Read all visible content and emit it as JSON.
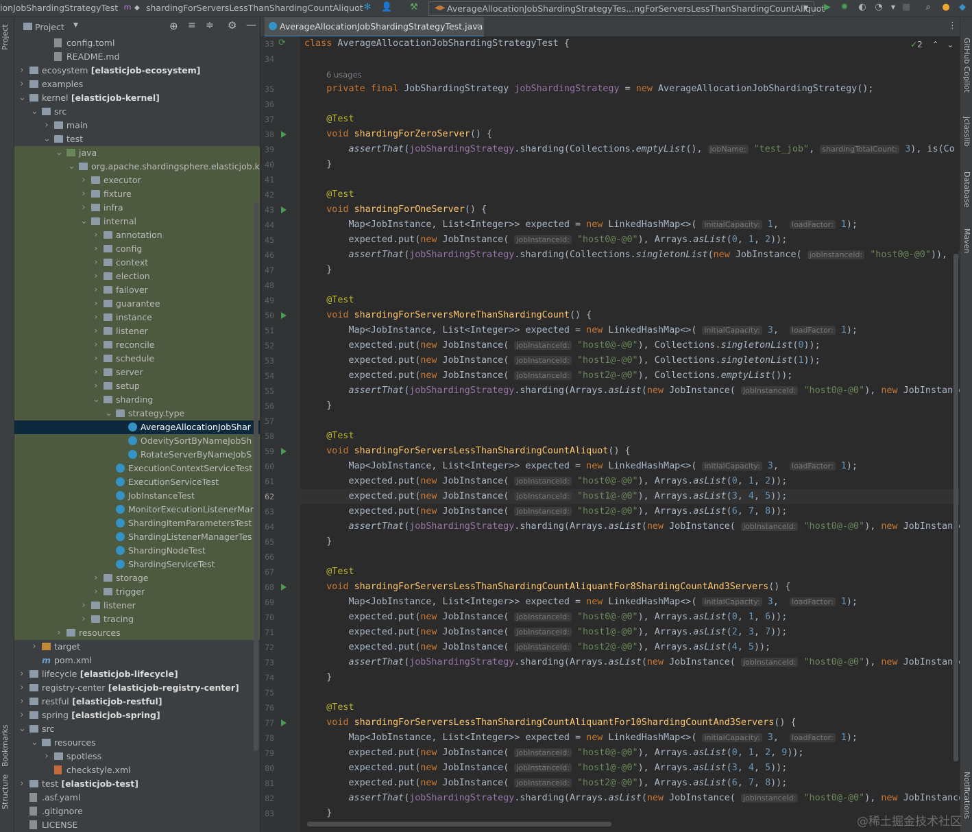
{
  "topbar": {
    "crumb_class": "ionJobShardingStrategyTest",
    "crumb_method": "shardingForServersLessThanShardingCountAliquot",
    "run_config": "AverageAllocationJobShardingStrategyTes...ngForServersLessThanShardingCountAliquot"
  },
  "stripes": {
    "project": "Project",
    "bookmarks": "Bookmarks",
    "structure": "Structure",
    "github_copilot": "GitHub Copilot",
    "jclasslib": "jclasslib",
    "database": "Database",
    "maven": "Maven",
    "notifications": "Notifications"
  },
  "project_panel": {
    "title": "Project",
    "tree": [
      {
        "label": "config.toml",
        "level": 3,
        "icon": "file",
        "expander": "none"
      },
      {
        "label": "README.md",
        "level": 3,
        "icon": "file",
        "expander": "none"
      },
      {
        "label": "ecosystem",
        "module": "[elasticjob-ecosystem]",
        "level": 1,
        "icon": "folder",
        "expander": "collapsed"
      },
      {
        "label": "examples",
        "level": 1,
        "icon": "folder",
        "expander": "collapsed"
      },
      {
        "label": "kernel",
        "module": "[elasticjob-kernel]",
        "level": 1,
        "icon": "folder",
        "expander": "expanded"
      },
      {
        "label": "src",
        "level": 2,
        "icon": "folder",
        "expander": "expanded"
      },
      {
        "label": "main",
        "level": 3,
        "icon": "folder",
        "expander": "collapsed"
      },
      {
        "label": "test",
        "level": 3,
        "icon": "folder",
        "expander": "expanded"
      },
      {
        "label": "java",
        "level": 4,
        "icon": "folder-green",
        "expander": "expanded"
      },
      {
        "label": "org.apache.shardingsphere.elasticjob.k",
        "level": 5,
        "icon": "folder",
        "expander": "expanded"
      },
      {
        "label": "executor",
        "level": 6,
        "icon": "folder",
        "expander": "collapsed"
      },
      {
        "label": "fixture",
        "level": 6,
        "icon": "folder",
        "expander": "collapsed"
      },
      {
        "label": "infra",
        "level": 6,
        "icon": "folder",
        "expander": "collapsed"
      },
      {
        "label": "internal",
        "level": 6,
        "icon": "folder",
        "expander": "expanded"
      },
      {
        "label": "annotation",
        "level": 7,
        "icon": "folder",
        "expander": "collapsed"
      },
      {
        "label": "config",
        "level": 7,
        "icon": "folder",
        "expander": "collapsed"
      },
      {
        "label": "context",
        "level": 7,
        "icon": "folder",
        "expander": "collapsed"
      },
      {
        "label": "election",
        "level": 7,
        "icon": "folder",
        "expander": "collapsed"
      },
      {
        "label": "failover",
        "level": 7,
        "icon": "folder",
        "expander": "collapsed"
      },
      {
        "label": "guarantee",
        "level": 7,
        "icon": "folder",
        "expander": "collapsed"
      },
      {
        "label": "instance",
        "level": 7,
        "icon": "folder",
        "expander": "collapsed"
      },
      {
        "label": "listener",
        "level": 7,
        "icon": "folder",
        "expander": "collapsed"
      },
      {
        "label": "reconcile",
        "level": 7,
        "icon": "folder",
        "expander": "collapsed"
      },
      {
        "label": "schedule",
        "level": 7,
        "icon": "folder",
        "expander": "collapsed"
      },
      {
        "label": "server",
        "level": 7,
        "icon": "folder",
        "expander": "collapsed"
      },
      {
        "label": "setup",
        "level": 7,
        "icon": "folder",
        "expander": "collapsed"
      },
      {
        "label": "sharding",
        "level": 7,
        "icon": "folder",
        "expander": "expanded"
      },
      {
        "label": "strategy.type",
        "level": 8,
        "icon": "folder",
        "expander": "expanded"
      },
      {
        "label": "AverageAllocationJobShar",
        "level": 9,
        "icon": "class",
        "expander": "none",
        "selected": true
      },
      {
        "label": "OdevitySortByNameJobSh",
        "level": 9,
        "icon": "class",
        "expander": "none"
      },
      {
        "label": "RotateServerByNameJobS",
        "level": 9,
        "icon": "class",
        "expander": "none"
      },
      {
        "label": "ExecutionContextServiceTest",
        "level": 8,
        "icon": "class",
        "expander": "none"
      },
      {
        "label": "ExecutionServiceTest",
        "level": 8,
        "icon": "class",
        "expander": "none"
      },
      {
        "label": "JobInstanceTest",
        "level": 8,
        "icon": "class",
        "expander": "none"
      },
      {
        "label": "MonitorExecutionListenerMan",
        "level": 8,
        "icon": "class",
        "expander": "none"
      },
      {
        "label": "ShardingItemParametersTest",
        "level": 8,
        "icon": "class",
        "expander": "none"
      },
      {
        "label": "ShardingListenerManagerTes",
        "level": 8,
        "icon": "class",
        "expander": "none"
      },
      {
        "label": "ShardingNodeTest",
        "level": 8,
        "icon": "class",
        "expander": "none"
      },
      {
        "label": "ShardingServiceTest",
        "level": 8,
        "icon": "class",
        "expander": "none"
      },
      {
        "label": "storage",
        "level": 7,
        "icon": "folder",
        "expander": "collapsed"
      },
      {
        "label": "trigger",
        "level": 7,
        "icon": "folder",
        "expander": "collapsed"
      },
      {
        "label": "listener",
        "level": 6,
        "icon": "folder",
        "expander": "collapsed"
      },
      {
        "label": "tracing",
        "level": 6,
        "icon": "folder",
        "expander": "collapsed"
      },
      {
        "label": "resources",
        "level": 4,
        "icon": "folder",
        "expander": "collapsed"
      },
      {
        "label": "target",
        "level": 2,
        "icon": "folder-orange",
        "expander": "collapsed"
      },
      {
        "label": "pom.xml",
        "level": 2,
        "icon": "maven",
        "expander": "none"
      },
      {
        "label": "lifecycle",
        "module": "[elasticjob-lifecycle]",
        "level": 1,
        "icon": "folder",
        "expander": "collapsed"
      },
      {
        "label": "registry-center",
        "module": "[elasticjob-registry-center]",
        "level": 1,
        "icon": "folder",
        "expander": "collapsed"
      },
      {
        "label": "restful",
        "module": "[elasticjob-restful]",
        "level": 1,
        "icon": "folder",
        "expander": "collapsed"
      },
      {
        "label": "spring",
        "module": "[elasticjob-spring]",
        "level": 1,
        "icon": "folder",
        "expander": "collapsed"
      },
      {
        "label": "src",
        "level": 1,
        "icon": "folder",
        "expander": "expanded"
      },
      {
        "label": "resources",
        "level": 2,
        "icon": "folder",
        "expander": "expanded"
      },
      {
        "label": "spotless",
        "level": 3,
        "icon": "folder",
        "expander": "collapsed"
      },
      {
        "label": "checkstyle.xml",
        "level": 3,
        "icon": "xml",
        "expander": "none"
      },
      {
        "label": "test",
        "module": "[elasticjob-test]",
        "level": 1,
        "icon": "folder",
        "expander": "collapsed"
      },
      {
        "label": ".asf.yaml",
        "level": 1,
        "icon": "file",
        "expander": "none"
      },
      {
        "label": ".gitignore",
        "level": 1,
        "icon": "file",
        "expander": "none"
      },
      {
        "label": "LICENSE",
        "level": 1,
        "icon": "file",
        "expander": "none"
      }
    ]
  },
  "editor": {
    "tab_label": "AverageAllocationJobShardingStrategyTest.java",
    "inspection_count": "2",
    "current_line": 62,
    "run_lines": [
      38,
      43,
      50,
      59,
      68,
      77
    ],
    "lines": [
      {
        "n": "33",
        "html": "<span style='color:#cc7832'>class</span> AverageAllocationJobShardingStrategyTest {"
      },
      {
        "n": "34",
        "html": ""
      },
      {
        "n": "",
        "usages": "6 usages"
      },
      {
        "n": "35",
        "html": "    <span style='color:#cc7832'>private final</span> JobShardingStrategy <span style='color:#9876aa'>jobShardingStrategy</span> = <span style='color:#cc7832'>new</span> AverageAllocationJobShardingStrategy();"
      },
      {
        "n": "36",
        "html": ""
      },
      {
        "n": "37",
        "html": "    <span style='color:#bbb529'>@Test</span>"
      },
      {
        "n": "38",
        "html": "    <span style='color:#cc7832'>void</span> <span style='color:#ffc66d'>shardingForZeroServer</span>() {"
      },
      {
        "n": "39",
        "html": "        <i>assertThat</i>(<span style='color:#9876aa'>jobShardingStrategy</span>.sharding(Collections.<i>emptyList</i>(), <span class='hint'>jobName:</span> <span style='color:#6a8759'>\"test_job\"</span>, <span class='hint'>shardingTotalCount:</span> <span style='color:#6897bb'>3</span>), is(Co"
      },
      {
        "n": "40",
        "html": "    }"
      },
      {
        "n": "41",
        "html": ""
      },
      {
        "n": "42",
        "html": "    <span style='color:#bbb529'>@Test</span>"
      },
      {
        "n": "43",
        "html": "    <span style='color:#cc7832'>void</span> <span style='color:#ffc66d'>shardingForOneServer</span>() {"
      },
      {
        "n": "44",
        "html": "        Map&lt;JobInstance, List&lt;Integer&gt;&gt; expected = <span style='color:#cc7832'>new</span> LinkedHashMap&lt;&gt;( <span class='hint'>initialCapacity:</span> <span style='color:#6897bb'>1</span>,  <span class='hint'>loadFactor:</span> <span style='color:#6897bb'>1</span>);"
      },
      {
        "n": "45",
        "html": "        expected.put(<span style='color:#cc7832'>new</span> JobInstance( <span class='hint'>jobInstanceId:</span> <span style='color:#6a8759'>\"host0@-@0\"</span>), Arrays.<i>asList</i>(<span style='color:#6897bb'>0</span>, <span style='color:#6897bb'>1</span>, <span style='color:#6897bb'>2</span>));"
      },
      {
        "n": "46",
        "html": "        <i>assertThat</i>(<span style='color:#9876aa'>jobShardingStrategy</span>.sharding(Collections.<i>singletonList</i>(<span style='color:#cc7832'>new</span> JobInstance( <span class='hint'>jobInstanceId:</span> <span style='color:#6a8759'>\"host0@-@0\"</span>)),  <span class='hint'>job</span>"
      },
      {
        "n": "47",
        "html": "    }"
      },
      {
        "n": "48",
        "html": ""
      },
      {
        "n": "49",
        "html": "    <span style='color:#bbb529'>@Test</span>"
      },
      {
        "n": "50",
        "html": "    <span style='color:#cc7832'>void</span> <span style='color:#ffc66d'>shardingForServersMoreThanShardingCount</span>() {"
      },
      {
        "n": "51",
        "html": "        Map&lt;JobInstance, List&lt;Integer&gt;&gt; expected = <span style='color:#cc7832'>new</span> LinkedHashMap&lt;&gt;( <span class='hint'>initialCapacity:</span> <span style='color:#6897bb'>3</span>,  <span class='hint'>loadFactor:</span> <span style='color:#6897bb'>1</span>);"
      },
      {
        "n": "52",
        "html": "        expected.put(<span style='color:#cc7832'>new</span> JobInstance( <span class='hint'>jobInstanceId:</span> <span style='color:#6a8759'>\"host0@-@0\"</span>), Collections.<i>singletonList</i>(<span style='color:#6897bb'>0</span>));"
      },
      {
        "n": "53",
        "html": "        expected.put(<span style='color:#cc7832'>new</span> JobInstance( <span class='hint'>jobInstanceId:</span> <span style='color:#6a8759'>\"host1@-@0\"</span>), Collections.<i>singletonList</i>(<span style='color:#6897bb'>1</span>));"
      },
      {
        "n": "54",
        "html": "        expected.put(<span style='color:#cc7832'>new</span> JobInstance( <span class='hint'>jobInstanceId:</span> <span style='color:#6a8759'>\"host2@-@0\"</span>), Collections.<i>emptyList</i>());"
      },
      {
        "n": "55",
        "html": "        <i>assertThat</i>(<span style='color:#9876aa'>jobShardingStrategy</span>.sharding(Arrays.<i>asList</i>(<span style='color:#cc7832'>new</span> JobInstance( <span class='hint'>jobInstanceId:</span> <span style='color:#6a8759'>\"host0@-@0\"</span>), <span style='color:#cc7832'>new</span> JobInstance("
      },
      {
        "n": "56",
        "html": "    }"
      },
      {
        "n": "57",
        "html": ""
      },
      {
        "n": "58",
        "html": "    <span style='color:#bbb529'>@Test</span>"
      },
      {
        "n": "59",
        "html": "    <span style='color:#cc7832'>void</span> <span style='color:#ffc66d'>shardingForServersLessThanShardingCountAliquot</span>() {"
      },
      {
        "n": "60",
        "html": "        Map&lt;JobInstance, List&lt;Integer&gt;&gt; expected = <span style='color:#cc7832'>new</span> LinkedHashMap&lt;&gt;( <span class='hint'>initialCapacity:</span> <span style='color:#6897bb'>3</span>,  <span class='hint'>loadFactor:</span> <span style='color:#6897bb'>1</span>);"
      },
      {
        "n": "61",
        "html": "        expected.put(<span style='color:#cc7832'>new</span> JobInstance( <span class='hint'>jobInstanceId:</span> <span style='color:#6a8759'>\"host0@-@0\"</span>), Arrays.<i>asList</i>(<span style='color:#6897bb'>0</span>, <span style='color:#6897bb'>1</span>, <span style='color:#6897bb'>2</span>));"
      },
      {
        "n": "62",
        "html": "        expected.put(<span style='color:#cc7832'>new</span> JobInstance( <span class='hint'>jobInstanceId:</span> <span style='color:#6a8759'>\"host1@-@0\"</span>), Arrays.<i>asList</i>(<span style='color:#6897bb'>3</span>, <span style='color:#6897bb'>4</span>, <span style='color:#6897bb'>5</span>));"
      },
      {
        "n": "63",
        "html": "        expected.put(<span style='color:#cc7832'>new</span> JobInstance( <span class='hint'>jobInstanceId:</span> <span style='color:#6a8759'>\"host2@-@0\"</span>), Arrays.<i>asList</i>(<span style='color:#6897bb'>6</span>, <span style='color:#6897bb'>7</span>, <span style='color:#6897bb'>8</span>));"
      },
      {
        "n": "64",
        "html": "        <i>assertThat</i>(<span style='color:#9876aa'>jobShardingStrategy</span>.sharding(Arrays.<i>asList</i>(<span style='color:#cc7832'>new</span> JobInstance( <span class='hint'>jobInstanceId:</span> <span style='color:#6a8759'>\"host0@-@0\"</span>), <span style='color:#cc7832'>new</span> JobInstance("
      },
      {
        "n": "65",
        "html": "    }"
      },
      {
        "n": "66",
        "html": ""
      },
      {
        "n": "67",
        "html": "    <span style='color:#bbb529'>@Test</span>"
      },
      {
        "n": "68",
        "html": "    <span style='color:#cc7832'>void</span> <span style='color:#ffc66d'>shardingForServersLessThanShardingCountAliquantFor8ShardingCountAnd3Servers</span>() {"
      },
      {
        "n": "69",
        "html": "        Map&lt;JobInstance, List&lt;Integer&gt;&gt; expected = <span style='color:#cc7832'>new</span> LinkedHashMap&lt;&gt;( <span class='hint'>initialCapacity:</span> <span style='color:#6897bb'>3</span>,  <span class='hint'>loadFactor:</span> <span style='color:#6897bb'>1</span>);"
      },
      {
        "n": "70",
        "html": "        expected.put(<span style='color:#cc7832'>new</span> JobInstance( <span class='hint'>jobInstanceId:</span> <span style='color:#6a8759'>\"host0@-@0\"</span>), Arrays.<i>asList</i>(<span style='color:#6897bb'>0</span>, <span style='color:#6897bb'>1</span>, <span style='color:#6897bb'>6</span>));"
      },
      {
        "n": "71",
        "html": "        expected.put(<span style='color:#cc7832'>new</span> JobInstance( <span class='hint'>jobInstanceId:</span> <span style='color:#6a8759'>\"host1@-@0\"</span>), Arrays.<i>asList</i>(<span style='color:#6897bb'>2</span>, <span style='color:#6897bb'>3</span>, <span style='color:#6897bb'>7</span>));"
      },
      {
        "n": "72",
        "html": "        expected.put(<span style='color:#cc7832'>new</span> JobInstance( <span class='hint'>jobInstanceId:</span> <span style='color:#6a8759'>\"host2@-@0\"</span>), Arrays.<i>asList</i>(<span style='color:#6897bb'>4</span>, <span style='color:#6897bb'>5</span>));"
      },
      {
        "n": "73",
        "html": "        <i>assertThat</i>(<span style='color:#9876aa'>jobShardingStrategy</span>.sharding(Arrays.<i>asList</i>(<span style='color:#cc7832'>new</span> JobInstance( <span class='hint'>jobInstanceId:</span> <span style='color:#6a8759'>\"host0@-@0\"</span>), <span style='color:#cc7832'>new</span> JobInstance("
      },
      {
        "n": "74",
        "html": "    }"
      },
      {
        "n": "75",
        "html": ""
      },
      {
        "n": "76",
        "html": "    <span style='color:#bbb529'>@Test</span>"
      },
      {
        "n": "77",
        "html": "    <span style='color:#cc7832'>void</span> <span style='color:#ffc66d'>shardingForServersLessThanShardingCountAliquantFor10ShardingCountAnd3Servers</span>() {"
      },
      {
        "n": "78",
        "html": "        Map&lt;JobInstance, List&lt;Integer&gt;&gt; expected = <span style='color:#cc7832'>new</span> LinkedHashMap&lt;&gt;( <span class='hint'>initialCapacity:</span> <span style='color:#6897bb'>3</span>,  <span class='hint'>loadFactor:</span> <span style='color:#6897bb'>1</span>);"
      },
      {
        "n": "79",
        "html": "        expected.put(<span style='color:#cc7832'>new</span> JobInstance( <span class='hint'>jobInstanceId:</span> <span style='color:#6a8759'>\"host0@-@0\"</span>), Arrays.<i>asList</i>(<span style='color:#6897bb'>0</span>, <span style='color:#6897bb'>1</span>, <span style='color:#6897bb'>2</span>, <span style='color:#6897bb'>9</span>));"
      },
      {
        "n": "80",
        "html": "        expected.put(<span style='color:#cc7832'>new</span> JobInstance( <span class='hint'>jobInstanceId:</span> <span style='color:#6a8759'>\"host1@-@0\"</span>), Arrays.<i>asList</i>(<span style='color:#6897bb'>3</span>, <span style='color:#6897bb'>4</span>, <span style='color:#6897bb'>5</span>));"
      },
      {
        "n": "81",
        "html": "        expected.put(<span style='color:#cc7832'>new</span> JobInstance( <span class='hint'>jobInstanceId:</span> <span style='color:#6a8759'>\"host2@-@0\"</span>), Arrays.<i>asList</i>(<span style='color:#6897bb'>6</span>, <span style='color:#6897bb'>7</span>, <span style='color:#6897bb'>8</span>));"
      },
      {
        "n": "82",
        "html": "        <i>assertThat</i>(<span style='color:#9876aa'>jobShardingStrategy</span>.sharding(Arrays.<i>asList</i>(<span style='color:#cc7832'>new</span> JobInstance( <span class='hint'>jobInstanceId:</span> <span style='color:#6a8759'>\"host0@-@0\"</span>), <span style='color:#cc7832'>new</span> JobInstance("
      },
      {
        "n": "83",
        "html": "    }"
      }
    ]
  },
  "watermark": "@稀土掘金技术社区",
  "colors": {
    "keyword": "#cc7832",
    "method": "#ffc66d",
    "field": "#9876aa",
    "string": "#6a8759",
    "number": "#6897bb",
    "annotation": "#bbb529",
    "selection": "#0d293e",
    "test_root_bg": "#4e5a3f"
  }
}
